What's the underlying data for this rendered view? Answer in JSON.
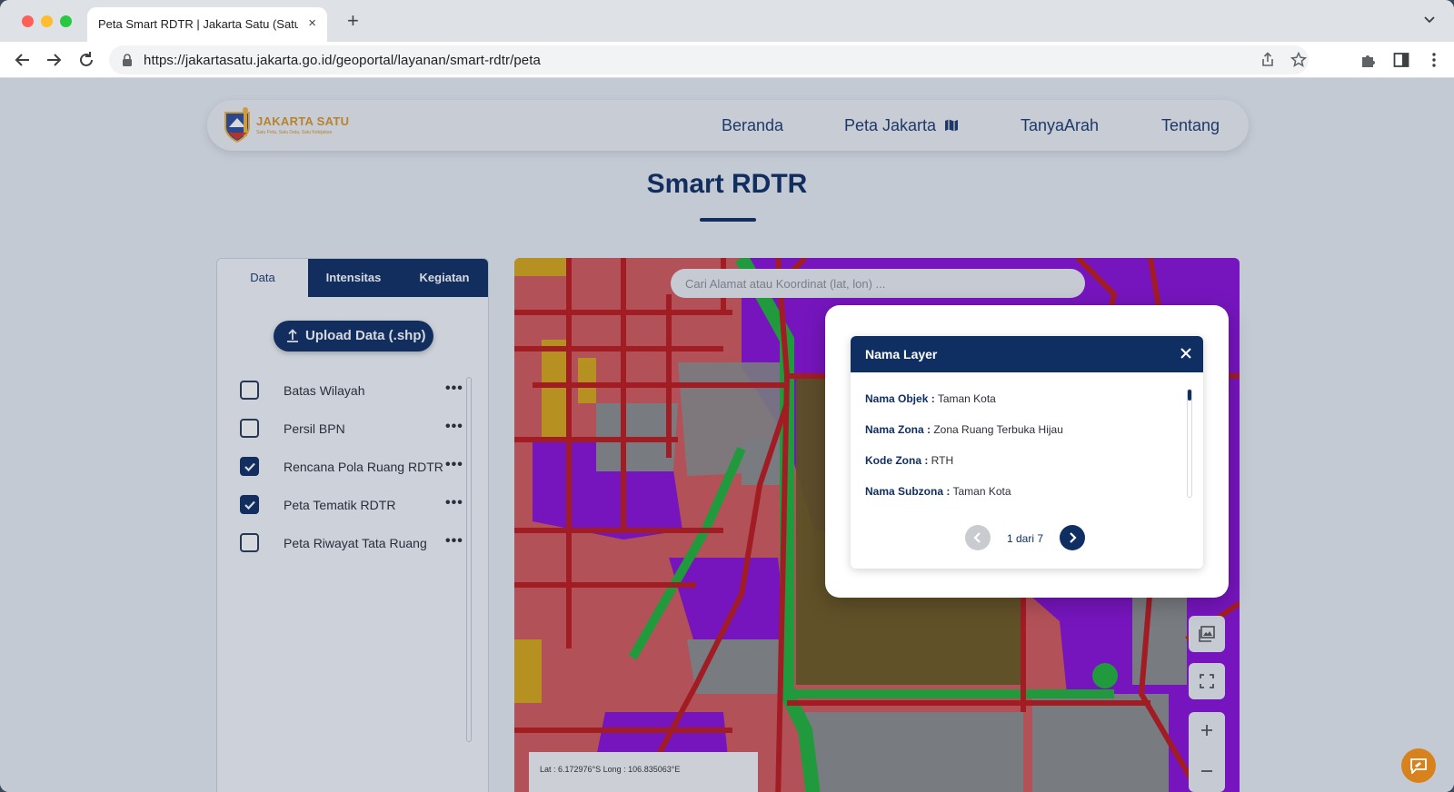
{
  "browser": {
    "tab_title": "Peta Smart RDTR | Jakarta Satu (Satu",
    "tab_close": "×",
    "new_tab": "+",
    "url": "https://jakartasatu.jakarta.go.id/geoportal/layanan/smart-rdtr/peta"
  },
  "site": {
    "logo_text": "JAKARTA SATU",
    "logo_tagline": "Satu Peta, Satu Data, Satu Kebijakan",
    "nav": [
      "Beranda",
      "Peta Jakarta",
      "TanyaArah",
      "Tentang"
    ],
    "page_title": "Smart RDTR"
  },
  "panel": {
    "tabs": [
      "Data",
      "Intensitas",
      "Kegiatan"
    ],
    "upload_label": "Upload Data (.shp)",
    "layers": [
      {
        "label": "Batas Wilayah",
        "checked": false
      },
      {
        "label": "Persil BPN",
        "checked": false
      },
      {
        "label": "Rencana Pola Ruang RDTR",
        "checked": true
      },
      {
        "label": "Peta Tematik RDTR",
        "checked": true
      },
      {
        "label": "Peta Riwayat Tata Ruang",
        "checked": false
      }
    ],
    "menu_glyph": "•••"
  },
  "map": {
    "search_placeholder": "Cari Alamat atau Koordinat (lat, lon) ...",
    "coords": "Lat :   6.172976°S   Long :   106.835063°E",
    "zone_colors": {
      "residential": "#d5595c",
      "commercial": "#8a10d8",
      "green": "#22b33a",
      "road": "#c0191d",
      "office": "#8d8d8d",
      "mixed": "#d9a61a",
      "park": "#6b5a1e"
    }
  },
  "popup": {
    "title": "Nama Layer",
    "attributes": [
      {
        "key": "Nama Objek :",
        "value": " Taman Kota"
      },
      {
        "key": "Nama Zona :",
        "value": " Zona Ruang Terbuka Hijau"
      },
      {
        "key": "Kode Zona :",
        "value": " RTH"
      },
      {
        "key": "Nama Subzona :",
        "value": " Taman Kota"
      }
    ],
    "pagination": "1 dari 7"
  }
}
